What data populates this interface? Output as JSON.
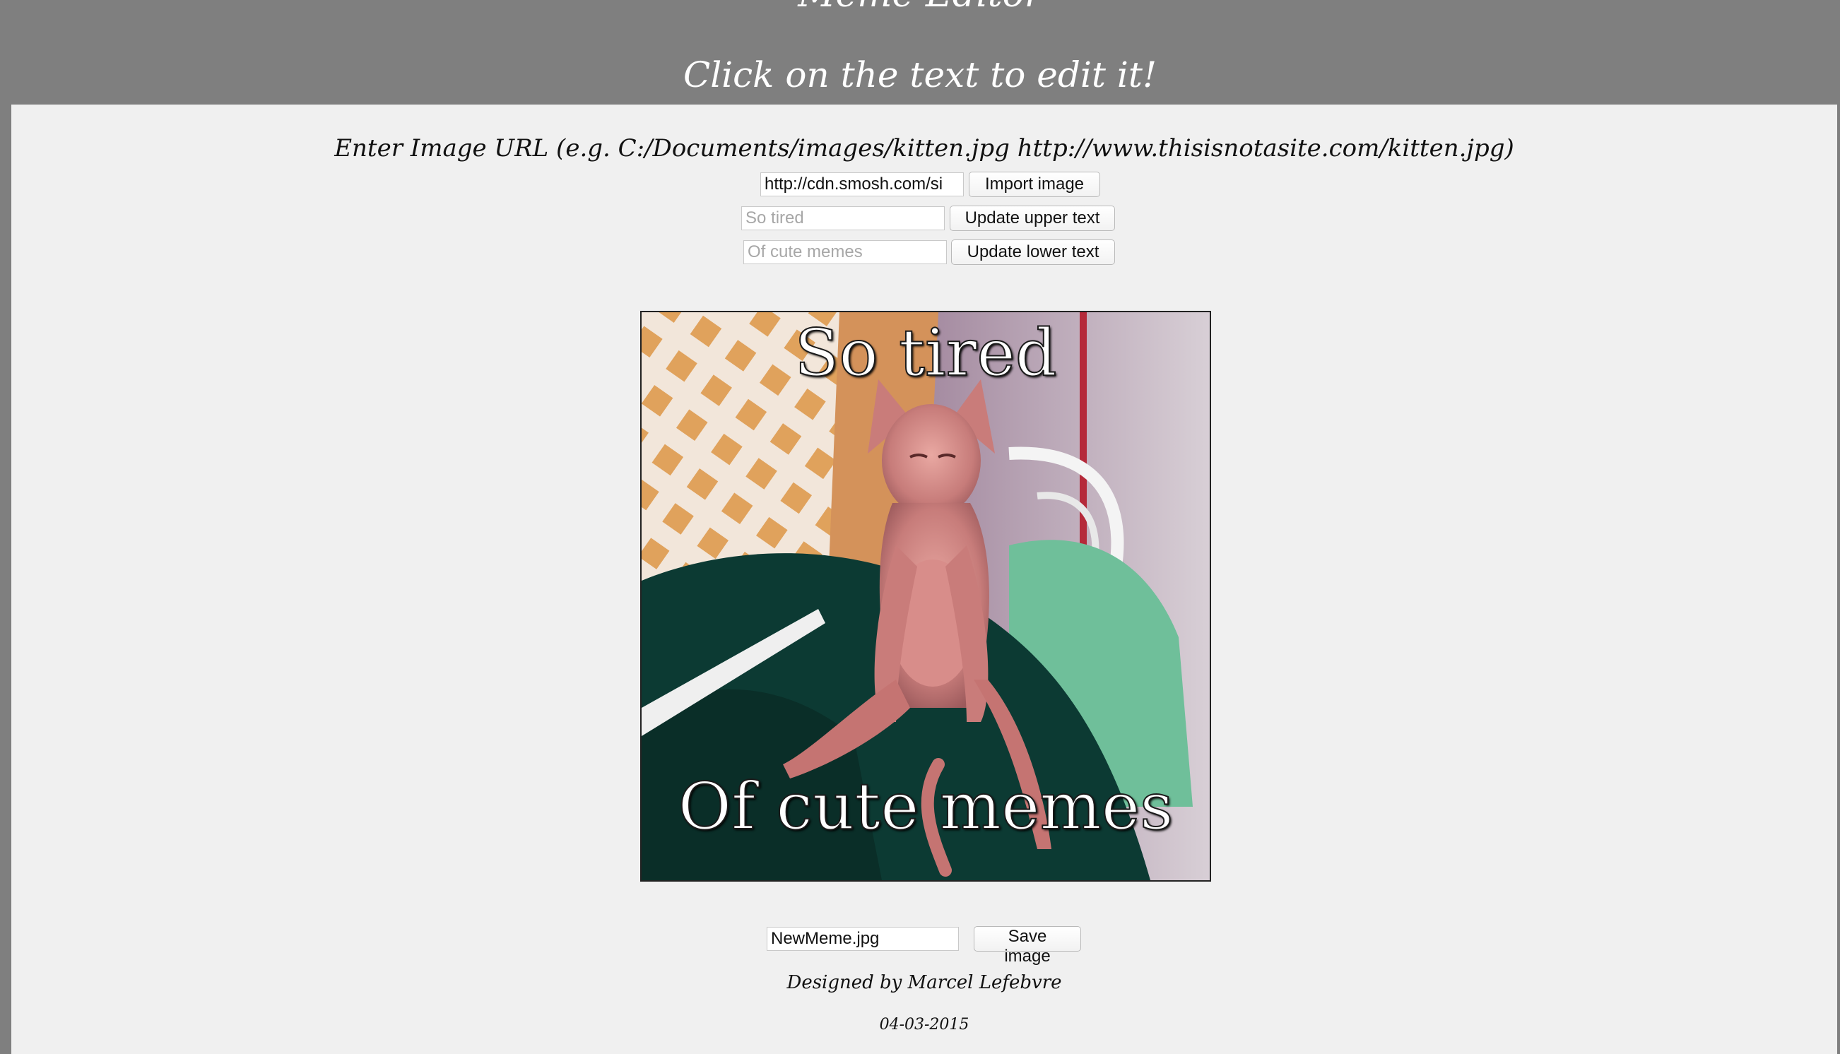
{
  "header": {
    "title": "Meme Editor",
    "subtitle": "Click on the text to edit it!"
  },
  "form": {
    "url_prompt": "Enter Image URL (e.g. C:/Documents/images/kitten.jpg http://www.thisisnotasite.com/kitten.jpg)",
    "url_value": "http://cdn.smosh.com/si",
    "import_label": "Import image",
    "upper_placeholder": "So tired",
    "upper_button": "Update upper text",
    "lower_placeholder": "Of cute memes",
    "lower_button": "Update lower text"
  },
  "meme": {
    "upper_text": "So tired",
    "lower_text": "Of cute memes",
    "image_subject": "hairless-cat-photo"
  },
  "save": {
    "filename_value": "NewMeme.jpg",
    "save_label": "Save image"
  },
  "footer": {
    "credit": "Designed by Marcel Lefebvre",
    "date": "04-03-2015"
  },
  "colors": {
    "header_bg": "#7f7f7f",
    "content_bg": "#f0f0f0",
    "header_text": "#ffffff"
  }
}
